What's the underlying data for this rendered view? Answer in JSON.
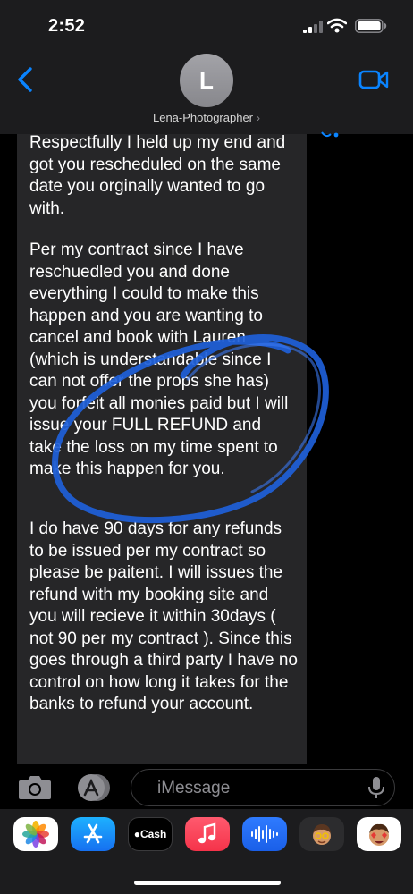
{
  "status": {
    "time": "2:52"
  },
  "header": {
    "contact_initial": "L",
    "contact_name": "Lena-Photographer",
    "chevron": "›"
  },
  "message": {
    "paragraphs": [
      "Respectfully I held up my end and got you rescheduled on the same date you orginally wanted to go with.",
      "Per my contract since I have reschuedled you and done everything I could to make this happen and you are wanting to cancel and book with Lauren (which is understandable since I can not offer the props she has) you forfeit all monies paid but  I will issue your FULL REFUND and take the loss on my time spent to make this happen for you.",
      "I do  have 90 days for any refunds to be issued per my contract so please be paitent.  I will issues the refund with my booking site and you will recieve it within 30days ( not 90 per my contract ). Since this goes through a third party I have no control on how long it takes for the banks to refund your account."
    ]
  },
  "input": {
    "placeholder": "iMessage"
  },
  "app_drawer": {
    "apps": [
      {
        "name": "photos-app-icon"
      },
      {
        "name": "app-store-app-icon"
      },
      {
        "name": "apple-cash-app-icon",
        "label": "Cash"
      },
      {
        "name": "music-app-icon"
      },
      {
        "name": "audio-message-app-icon"
      },
      {
        "name": "memoji-app-icon"
      },
      {
        "name": "memoji-stickers-app-icon"
      }
    ]
  },
  "colors": {
    "accent": "#0a84ff",
    "bubble": "#262628",
    "annotation": "#1e5fd9"
  }
}
